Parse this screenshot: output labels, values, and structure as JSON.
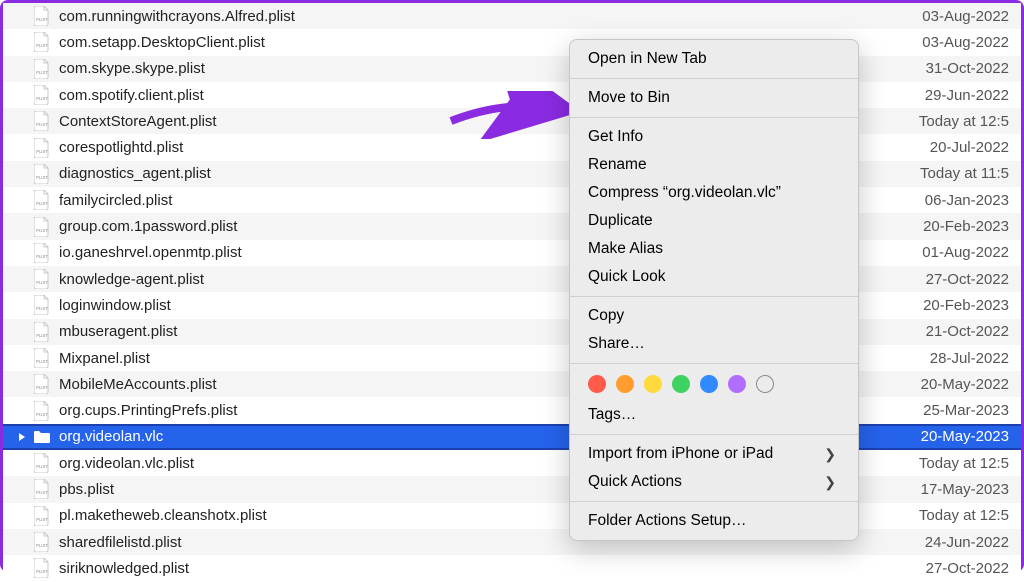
{
  "files": [
    {
      "name": "com.runningwithcrayons.Alfred.plist",
      "date": "03-Aug-2022",
      "type": "plist",
      "selected": false
    },
    {
      "name": "com.setapp.DesktopClient.plist",
      "date": "03-Aug-2022",
      "type": "plist",
      "selected": false
    },
    {
      "name": "com.skype.skype.plist",
      "date": "31-Oct-2022",
      "type": "plist",
      "selected": false
    },
    {
      "name": "com.spotify.client.plist",
      "date": "29-Jun-2022",
      "type": "plist",
      "selected": false
    },
    {
      "name": "ContextStoreAgent.plist",
      "date": "Today at 12:5",
      "type": "plist",
      "selected": false
    },
    {
      "name": "corespotlightd.plist",
      "date": "20-Jul-2022",
      "type": "plist",
      "selected": false
    },
    {
      "name": "diagnostics_agent.plist",
      "date": "Today at 11:5",
      "type": "plist",
      "selected": false
    },
    {
      "name": "familycircled.plist",
      "date": "06-Jan-2023",
      "type": "plist",
      "selected": false
    },
    {
      "name": "group.com.1password.plist",
      "date": "20-Feb-2023",
      "type": "plist",
      "selected": false
    },
    {
      "name": "io.ganeshrvel.openmtp.plist",
      "date": "01-Aug-2022",
      "type": "plist",
      "selected": false
    },
    {
      "name": "knowledge-agent.plist",
      "date": "27-Oct-2022",
      "type": "plist",
      "selected": false
    },
    {
      "name": "loginwindow.plist",
      "date": "20-Feb-2023",
      "type": "plist",
      "selected": false
    },
    {
      "name": "mbuseragent.plist",
      "date": "21-Oct-2022",
      "type": "plist",
      "selected": false
    },
    {
      "name": "Mixpanel.plist",
      "date": "28-Jul-2022",
      "type": "plist",
      "selected": false
    },
    {
      "name": "MobileMeAccounts.plist",
      "date": "20-May-2022",
      "type": "plist",
      "selected": false
    },
    {
      "name": "org.cups.PrintingPrefs.plist",
      "date": "25-Mar-2023",
      "type": "plist",
      "selected": false
    },
    {
      "name": "org.videolan.vlc",
      "date": "20-May-2023",
      "type": "folder",
      "selected": true
    },
    {
      "name": "org.videolan.vlc.plist",
      "date": "Today at 12:5",
      "type": "plist",
      "selected": false
    },
    {
      "name": "pbs.plist",
      "date": "17-May-2023",
      "type": "plist",
      "selected": false
    },
    {
      "name": "pl.maketheweb.cleanshotx.plist",
      "date": "Today at 12:5",
      "type": "plist",
      "selected": false
    },
    {
      "name": "sharedfilelistd.plist",
      "date": "24-Jun-2022",
      "type": "plist",
      "selected": false
    },
    {
      "name": "siriknowledged.plist",
      "date": "27-Oct-2022",
      "type": "plist",
      "selected": false
    }
  ],
  "contextMenu": {
    "openNewTab": "Open in New Tab",
    "moveToBin": "Move to Bin",
    "getInfo": "Get Info",
    "rename": "Rename",
    "compress": "Compress “org.videolan.vlc”",
    "duplicate": "Duplicate",
    "makeAlias": "Make Alias",
    "quickLook": "Quick Look",
    "copy": "Copy",
    "share": "Share…",
    "tags": "Tags…",
    "importFrom": "Import from iPhone or iPad",
    "quickActions": "Quick Actions",
    "folderActions": "Folder Actions Setup…"
  },
  "tagColors": [
    "#ff5b4b",
    "#ff9d2f",
    "#ffd93b",
    "#3fd262",
    "#2f8bff",
    "#b06dff"
  ],
  "arrow": {
    "color": "#8a2be2"
  }
}
